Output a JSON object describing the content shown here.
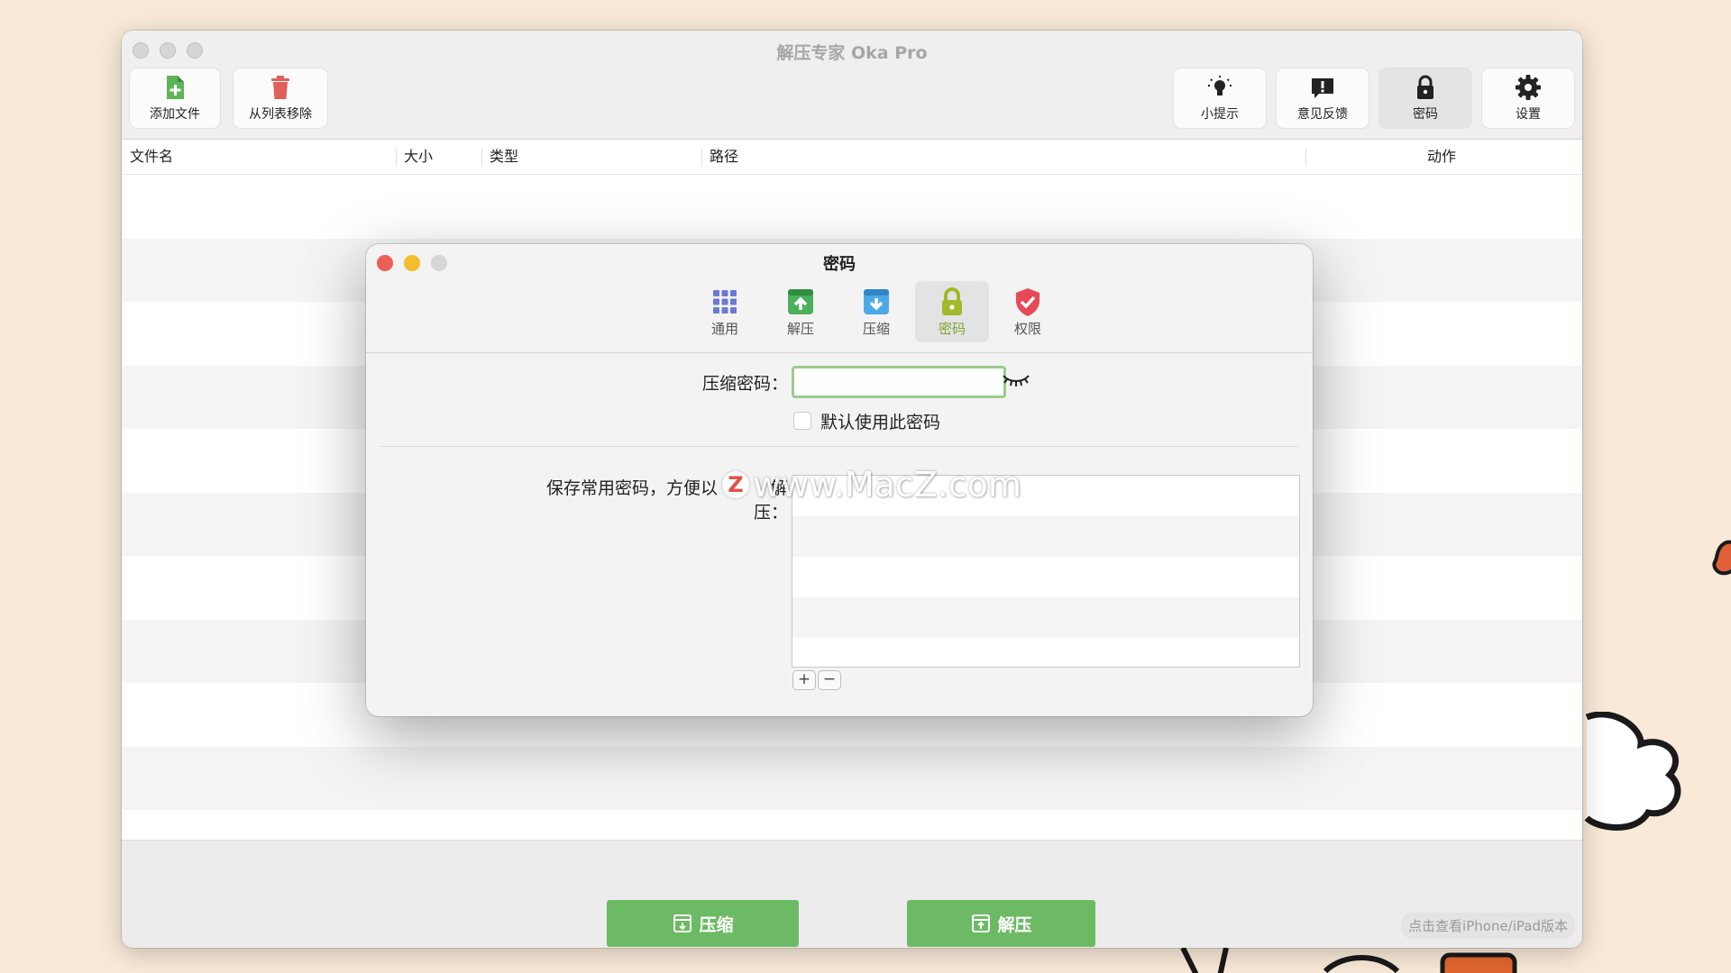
{
  "window": {
    "title": "解压专家 Oka Pro"
  },
  "toolbar": {
    "add_file": "添加文件",
    "remove_from_list": "从列表移除",
    "tips": "小提示",
    "feedback": "意见反馈",
    "password": "密码",
    "settings": "设置"
  },
  "columns": [
    "文件名",
    "大小",
    "类型",
    "路径",
    "动作"
  ],
  "footer": {
    "compress": "压缩",
    "extract": "解压",
    "ipad_link": "点击查看iPhone/iPad版本"
  },
  "dialog": {
    "title": "密码",
    "tabs": [
      {
        "label": "通用",
        "icon": "grid-icon"
      },
      {
        "label": "解压",
        "icon": "extract-box-icon"
      },
      {
        "label": "压缩",
        "icon": "compress-box-icon"
      },
      {
        "label": "密码",
        "icon": "lock-icon",
        "active": true
      },
      {
        "label": "权限",
        "icon": "shield-check-icon"
      }
    ],
    "password_label": "压缩密码：",
    "password_value": "",
    "default_checkbox_label": "默认使用此密码",
    "default_checked": false,
    "saved_label": "保存常用密码，方便以",
    "saved_label_tail": "解压：",
    "add_button": "+",
    "remove_button": "−"
  },
  "watermark": {
    "logo": "Z",
    "text": "www.MacZ.com"
  },
  "colors": {
    "accent_green": "#6cba64",
    "active_tab_green": "#7aa632",
    "close": "#ec5f55",
    "minimize": "#f4bd2f"
  }
}
